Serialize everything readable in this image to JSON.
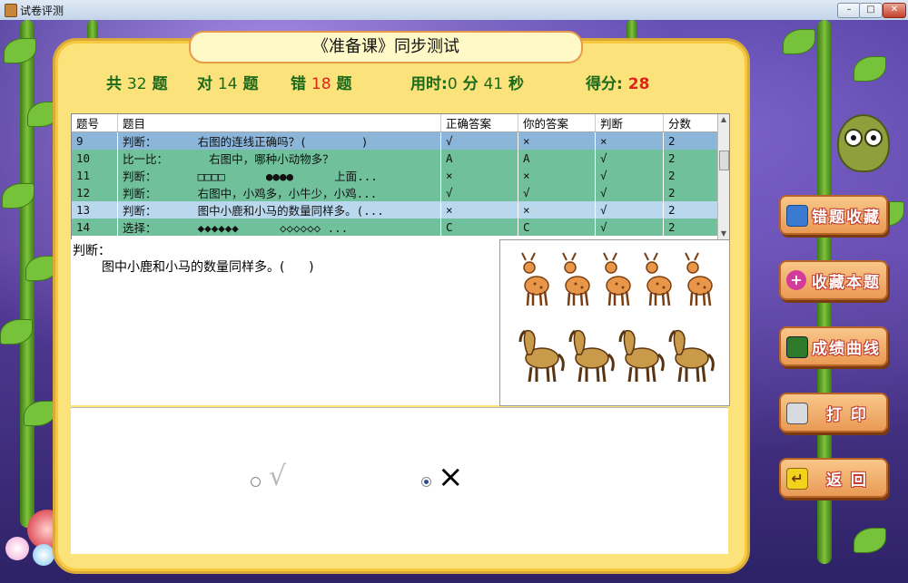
{
  "window": {
    "title": "试卷评测"
  },
  "header": {
    "title": "《准备课》同步测试",
    "total_label": "共",
    "total": "32",
    "total_unit": "题",
    "right_label": "对",
    "right": "14",
    "right_unit": "题",
    "wrong_label": "错",
    "wrong": "18",
    "wrong_unit": "题",
    "time_label": "用时:",
    "time_min": "0",
    "time_min_unit": "分",
    "time_sec": "41",
    "time_sec_unit": "秒",
    "score_label": "得分:",
    "score": "28"
  },
  "grid": {
    "columns": [
      "题号",
      "题目",
      "正确答案",
      "你的答案",
      "判断",
      "分数"
    ],
    "rows": [
      {
        "no": "9",
        "q": "判断：      右图的连线正确吗？(        )",
        "correct": "√",
        "yours": "×",
        "judge": "×",
        "score": "2"
      },
      {
        "no": "10",
        "q": "比一比：      右图中，哪种小动物多？",
        "correct": "A",
        "yours": "A",
        "judge": "√",
        "score": "2"
      },
      {
        "no": "11",
        "q": "判断：      □□□□      ●●●●      上面...",
        "correct": "×",
        "yours": "×",
        "judge": "√",
        "score": "2"
      },
      {
        "no": "12",
        "q": "判断：      右图中，小鸡多，小牛少，小鸡...",
        "correct": "√",
        "yours": "√",
        "judge": "√",
        "score": "2"
      },
      {
        "no": "13",
        "q": "判断：      图中小鹿和小马的数量同样多。(...",
        "correct": "×",
        "yours": "×",
        "judge": "√",
        "score": "2"
      },
      {
        "no": "14",
        "q": "选择：      ◆◆◆◆◆◆      ◇◇◇◇◇◇ ...",
        "correct": "C",
        "yours": "C",
        "judge": "√",
        "score": "2"
      }
    ]
  },
  "question": {
    "type": "判断：",
    "text": "图中小鹿和小马的数量同样多。(      )"
  },
  "answer": {
    "option_true": "√",
    "option_false": "×",
    "selected": "false"
  },
  "buttons": {
    "wrong_collection": "错题收藏",
    "collect": "收藏本题",
    "score_curve": "成绩曲线",
    "print": "打 印",
    "back": "返 回"
  },
  "picture": {
    "deer_count": 5,
    "horse_count": 4
  }
}
